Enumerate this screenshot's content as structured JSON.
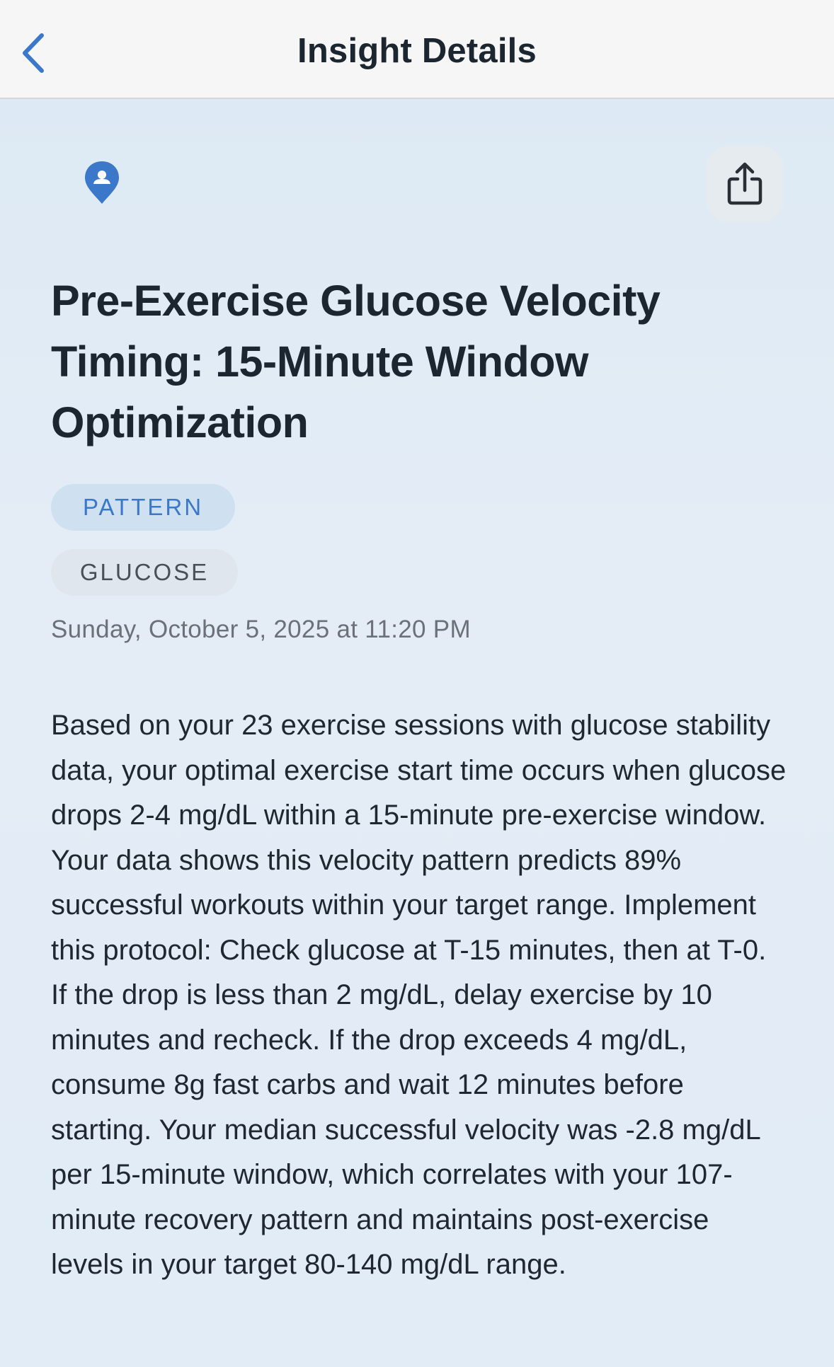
{
  "nav": {
    "title": "Insight Details",
    "back_icon": "chevron-left-icon"
  },
  "header": {
    "category_icon": "location-pin-icon",
    "share_icon": "share-icon"
  },
  "insight": {
    "title": "Pre-Exercise Glucose Velocity Timing: 15-Minute Window Optimization",
    "tags": [
      {
        "label": "PATTERN",
        "color": "#3b78c9",
        "background": "#cfe0f1"
      },
      {
        "label": "GLUCOSE",
        "color": "#4a4f57",
        "background": "#dfe6ee"
      }
    ],
    "date": "Sunday, October 5, 2025 at 11:20 PM",
    "body": "Based on your 23 exercise sessions with glucose stability data, your optimal exercise start time occurs when glucose drops 2-4 mg/dL within a 15-minute pre-exercise window. Your data shows this velocity pattern predicts 89% successful workouts within your target range. Implement this protocol: Check glucose at T-15 minutes, then at T-0. If the drop is less than 2 mg/dL, delay exercise by 10 minutes and recheck. If the drop exceeds 4 mg/dL, consume 8g fast carbs and wait 12 minutes before starting. Your median successful velocity was -2.8 mg/dL per 15-minute window, which correlates with your 107-minute recovery pattern and maintains post-exercise levels in your target 80-140 mg/dL range."
  },
  "colors": {
    "accent": "#3b78c9",
    "text_primary": "#1c2630",
    "text_secondary": "#6c7078",
    "background": "#e4edf6"
  }
}
